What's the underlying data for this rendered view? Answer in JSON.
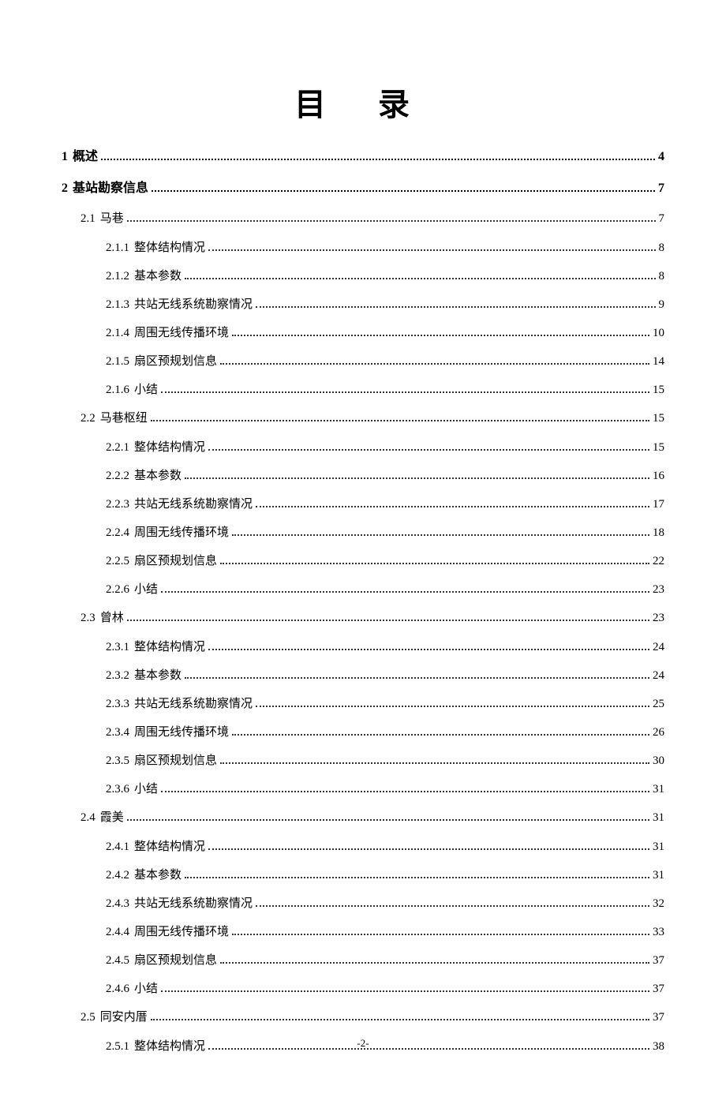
{
  "title": "目 录",
  "page_number": "-2-",
  "toc": [
    {
      "level": 1,
      "num": "1",
      "label": "概述",
      "page": "4"
    },
    {
      "level": 1,
      "num": "2",
      "label": "基站勘察信息",
      "page": "7"
    },
    {
      "level": 2,
      "num": "2.1",
      "label": "马巷",
      "page": "7"
    },
    {
      "level": 3,
      "num": "2.1.1",
      "label": "整体结构情况",
      "page": "8"
    },
    {
      "level": 3,
      "num": "2.1.2",
      "label": "基本参数",
      "page": "8"
    },
    {
      "level": 3,
      "num": "2.1.3",
      "label": "共站无线系统勘察情况",
      "page": "9"
    },
    {
      "level": 3,
      "num": "2.1.4",
      "label": "周围无线传播环境",
      "page": "10"
    },
    {
      "level": 3,
      "num": "2.1.5",
      "label": "扇区预规划信息",
      "page": "14"
    },
    {
      "level": 3,
      "num": "2.1.6",
      "label": "小结",
      "page": "15"
    },
    {
      "level": 2,
      "num": "2.2",
      "label": "马巷枢纽",
      "page": "15"
    },
    {
      "level": 3,
      "num": "2.2.1",
      "label": "整体结构情况",
      "page": "15"
    },
    {
      "level": 3,
      "num": "2.2.2",
      "label": "基本参数",
      "page": "16"
    },
    {
      "level": 3,
      "num": "2.2.3",
      "label": "共站无线系统勘察情况",
      "page": "17"
    },
    {
      "level": 3,
      "num": "2.2.4",
      "label": "周围无线传播环境",
      "page": "18"
    },
    {
      "level": 3,
      "num": "2.2.5",
      "label": "扇区预规划信息",
      "page": "22"
    },
    {
      "level": 3,
      "num": "2.2.6",
      "label": "小结",
      "page": "23"
    },
    {
      "level": 2,
      "num": "2.3",
      "label": "曾林",
      "page": "23"
    },
    {
      "level": 3,
      "num": "2.3.1",
      "label": "整体结构情况",
      "page": "24"
    },
    {
      "level": 3,
      "num": "2.3.2",
      "label": "基本参数",
      "page": "24"
    },
    {
      "level": 3,
      "num": "2.3.3",
      "label": "共站无线系统勘察情况",
      "page": "25"
    },
    {
      "level": 3,
      "num": "2.3.4",
      "label": "周围无线传播环境",
      "page": "26"
    },
    {
      "level": 3,
      "num": "2.3.5",
      "label": "扇区预规划信息",
      "page": "30"
    },
    {
      "level": 3,
      "num": "2.3.6",
      "label": "小结",
      "page": "31"
    },
    {
      "level": 2,
      "num": "2.4",
      "label": "霞美",
      "page": "31"
    },
    {
      "level": 3,
      "num": "2.4.1",
      "label": "整体结构情况",
      "page": "31"
    },
    {
      "level": 3,
      "num": "2.4.2",
      "label": "基本参数",
      "page": "31"
    },
    {
      "level": 3,
      "num": "2.4.3",
      "label": "共站无线系统勘察情况",
      "page": "32"
    },
    {
      "level": 3,
      "num": "2.4.4",
      "label": "周围无线传播环境",
      "page": "33"
    },
    {
      "level": 3,
      "num": "2.4.5",
      "label": "扇区预规划信息",
      "page": "37"
    },
    {
      "level": 3,
      "num": "2.4.6",
      "label": "小结",
      "page": "37"
    },
    {
      "level": 2,
      "num": "2.5",
      "label": "同安内厝",
      "page": "37"
    },
    {
      "level": 3,
      "num": "2.5.1",
      "label": "整体结构情况",
      "page": "38"
    }
  ]
}
